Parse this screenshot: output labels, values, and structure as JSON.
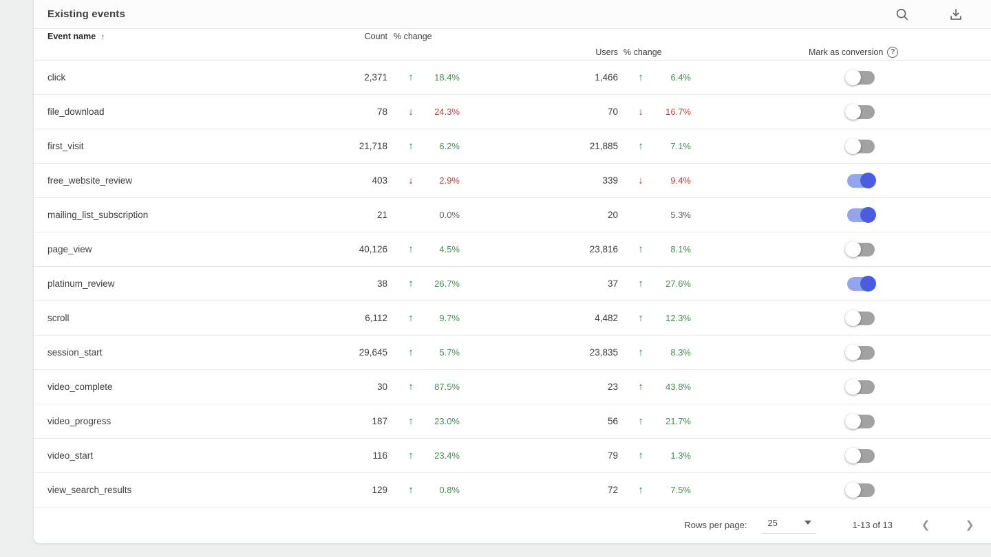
{
  "card": {
    "title": "Existing events"
  },
  "table": {
    "columns": {
      "event_name": "Event name",
      "count": "Count",
      "count_pct_change": "% change",
      "users": "Users",
      "users_pct_change": "% change",
      "mark_as_conversion": "Mark as conversion",
      "help_glyph": "?"
    },
    "rows": [
      {
        "name": "click",
        "count": "2,371",
        "count_dir": "up",
        "count_pct": "18.4%",
        "users": "1,466",
        "users_dir": "up",
        "users_pct": "6.4%",
        "conversion": false
      },
      {
        "name": "file_download",
        "count": "78",
        "count_dir": "down",
        "count_pct": "24.3%",
        "users": "70",
        "users_dir": "down",
        "users_pct": "16.7%",
        "conversion": false
      },
      {
        "name": "first_visit",
        "count": "21,718",
        "count_dir": "up",
        "count_pct": "6.2%",
        "users": "21,885",
        "users_dir": "up",
        "users_pct": "7.1%",
        "conversion": false
      },
      {
        "name": "free_website_review",
        "count": "403",
        "count_dir": "down",
        "count_pct": "2.9%",
        "users": "339",
        "users_dir": "down",
        "users_pct": "9.4%",
        "conversion": true
      },
      {
        "name": "mailing_list_subscription",
        "count": "21",
        "count_dir": "none",
        "count_pct": "0.0%",
        "users": "20",
        "users_dir": "none",
        "users_pct": "5.3%",
        "conversion": true
      },
      {
        "name": "page_view",
        "count": "40,126",
        "count_dir": "up",
        "count_pct": "4.5%",
        "users": "23,816",
        "users_dir": "up",
        "users_pct": "8.1%",
        "conversion": false
      },
      {
        "name": "platinum_review",
        "count": "38",
        "count_dir": "up",
        "count_pct": "26.7%",
        "users": "37",
        "users_dir": "up",
        "users_pct": "27.6%",
        "conversion": true
      },
      {
        "name": "scroll",
        "count": "6,112",
        "count_dir": "up",
        "count_pct": "9.7%",
        "users": "4,482",
        "users_dir": "up",
        "users_pct": "12.3%",
        "conversion": false
      },
      {
        "name": "session_start",
        "count": "29,645",
        "count_dir": "up",
        "count_pct": "5.7%",
        "users": "23,835",
        "users_dir": "up",
        "users_pct": "8.3%",
        "conversion": false
      },
      {
        "name": "video_complete",
        "count": "30",
        "count_dir": "up",
        "count_pct": "87.5%",
        "users": "23",
        "users_dir": "up",
        "users_pct": "43.8%",
        "conversion": false
      },
      {
        "name": "video_progress",
        "count": "187",
        "count_dir": "up",
        "count_pct": "23.0%",
        "users": "56",
        "users_dir": "up",
        "users_pct": "21.7%",
        "conversion": false
      },
      {
        "name": "video_start",
        "count": "116",
        "count_dir": "up",
        "count_pct": "23.4%",
        "users": "79",
        "users_dir": "up",
        "users_pct": "1.3%",
        "conversion": false
      },
      {
        "name": "view_search_results",
        "count": "129",
        "count_dir": "up",
        "count_pct": "0.8%",
        "users": "72",
        "users_dir": "up",
        "users_pct": "7.5%",
        "conversion": false
      }
    ],
    "sort": {
      "column": "Event name",
      "direction": "ascending",
      "glyph": "↑"
    },
    "arrow_glyphs": {
      "up": "↑",
      "down": "↓"
    }
  },
  "footer": {
    "rows_per_page_label": "Rows per page:",
    "rows_per_page_value": "25",
    "range_label": "1-13 of 13",
    "prev_glyph": "❮",
    "next_glyph": "❯"
  },
  "colors": {
    "trend_up": "#1f8a3d",
    "trend_down": "#b3372c",
    "trend_neutral": "#5f6368",
    "toggle_on_thumb": "#4a5de0",
    "toggle_on_track": "#93a5ee",
    "toggle_off_track": "#a2a2a2",
    "page_background": "#eef0ef"
  }
}
